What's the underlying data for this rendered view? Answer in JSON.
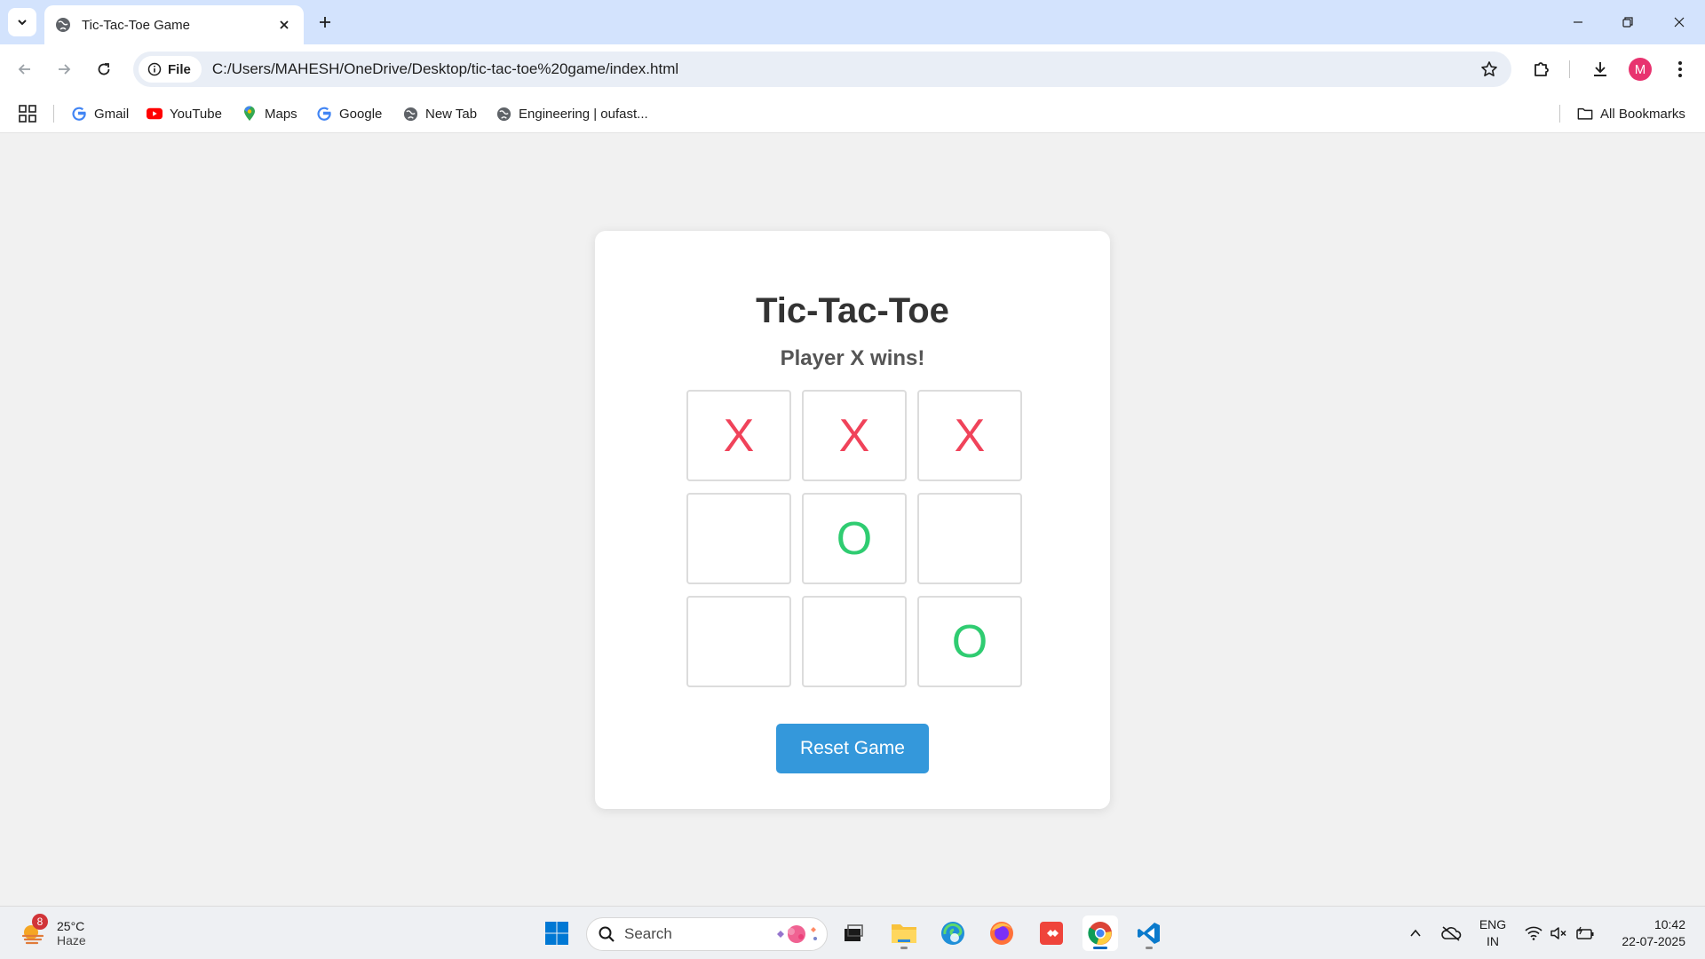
{
  "browser": {
    "tab_title": "Tic-Tac-Toe Game",
    "address_chip": "File",
    "url": "C:/Users/MAHESH/OneDrive/Desktop/tic-tac-toe%20game/index.html",
    "profile_initial": "M"
  },
  "bookmarks": {
    "items": [
      {
        "label": "Gmail",
        "icon": "google-icon"
      },
      {
        "label": "YouTube",
        "icon": "youtube-icon"
      },
      {
        "label": "Maps",
        "icon": "maps-icon"
      },
      {
        "label": "Google",
        "icon": "google-icon"
      },
      {
        "label": "New Tab",
        "icon": "globe-icon"
      },
      {
        "label": "Engineering | oufast...",
        "icon": "globe-icon"
      }
    ],
    "all_bookmarks": "All Bookmarks"
  },
  "game": {
    "title": "Tic-Tac-Toe",
    "status": "Player X wins!",
    "board": [
      "X",
      "X",
      "X",
      "",
      "O",
      "",
      "",
      "",
      "O"
    ],
    "reset_label": "Reset Game",
    "colors": {
      "x": "#f0435a",
      "o": "#2fcc71",
      "button": "#3498db"
    }
  },
  "taskbar": {
    "weather_badge": "8",
    "weather_temp": "25°C",
    "weather_desc": "Haze",
    "search_label": "Search",
    "apps": [
      "start",
      "search",
      "task-view",
      "file-explorer",
      "edge",
      "firefox",
      "anydesk",
      "chrome",
      "vscode"
    ],
    "lang_top": "ENG",
    "lang_bottom": "IN",
    "time": "10:42",
    "date": "22-07-2025"
  }
}
